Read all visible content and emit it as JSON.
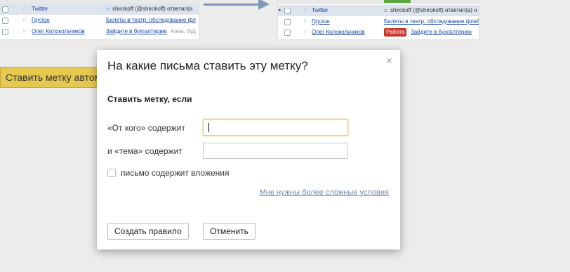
{
  "background": {
    "left_list": [
      {
        "sender": "Twitter",
        "subject": "shirokoff (@shirokoff) ответил(а",
        "icon": "twitter-icon",
        "selected": true
      },
      {
        "sender": "Грулон",
        "subject": "Билеты в театр, обследование фл",
        "selected": false
      },
      {
        "sender": "Олег Колокольчиков",
        "subject": "Зайдите в бухгалтерию",
        "preview": "Анна, буд",
        "selected": false
      }
    ],
    "right_list": [
      {
        "sender": "Twitter",
        "subject": "shirokoff (@shirokoff) ответил(а) н",
        "icon": "twitter-icon",
        "selected": true
      },
      {
        "sender": "Грулон",
        "subject": "Билеты в театр, обследование флеб",
        "selected": false
      },
      {
        "sender": "Олег Колокольчиков",
        "tag": "Работа",
        "subject": "Зайдите в бухгалтерию",
        "selected": false
      }
    ],
    "auto_button_label": "Ставить метку автома"
  },
  "dialog": {
    "title": "На какие письма ставить эту метку?",
    "close_symbol": "×",
    "section_title": "Ставить метку, если",
    "from_label": "«От кого» содержит",
    "from_value": "",
    "subject_label": "и «тема» содержит",
    "subject_value": "",
    "attachment_label": "письмо содержит вложения",
    "attachment_checked": false,
    "more_conditions_link": "Мне нужны более сложные условия",
    "create_button": "Создать правило",
    "cancel_button": "Отменить"
  },
  "colors": {
    "accent_yellow": "#e7c84f",
    "link_blue": "#1a47a0",
    "tag_red": "#c8382c",
    "arrow": "#7f98b8"
  }
}
